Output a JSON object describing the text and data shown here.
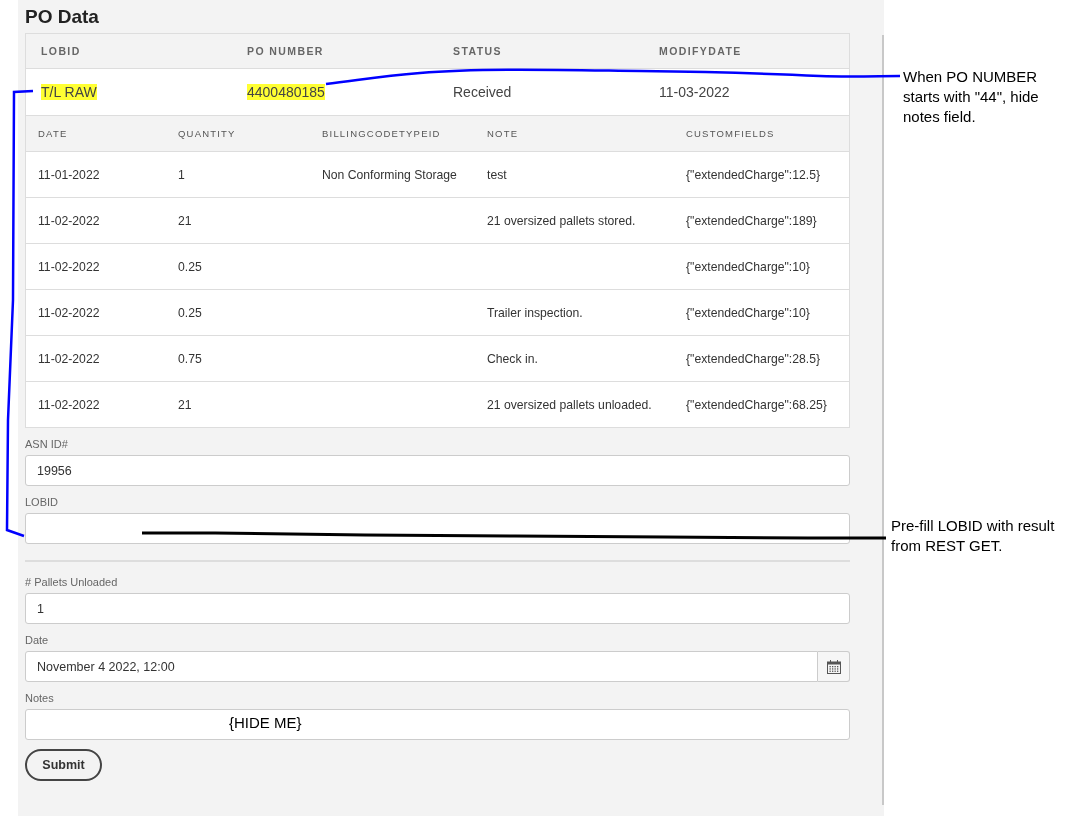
{
  "title": "PO Data",
  "po_table": {
    "columns": [
      "LOBID",
      "PO NUMBER",
      "STATUS",
      "MODIFYDATE"
    ],
    "row": [
      {
        "text": "T/L RAW",
        "highlighted": true
      },
      {
        "text": "4400480185",
        "highlighted": true
      },
      {
        "text": "Received",
        "highlighted": false
      },
      {
        "text": "11-03-2022",
        "highlighted": false
      }
    ]
  },
  "charges_table": {
    "columns": [
      "DATE",
      "QUANTITY",
      "BILLINGCODETYPEID",
      "NOTE",
      "CUSTOMFIELDS"
    ],
    "rows": [
      [
        "11-01-2022",
        "1",
        "Non Conforming Storage",
        "test",
        "{\"extendedCharge\":12.5}"
      ],
      [
        "11-02-2022",
        "21",
        "",
        "21 oversized pallets stored.",
        "{\"extendedCharge\":189}"
      ],
      [
        "11-02-2022",
        "0.25",
        "",
        "",
        "{\"extendedCharge\":10}"
      ],
      [
        "11-02-2022",
        "0.25",
        "",
        "Trailer inspection.",
        "{\"extendedCharge\":10}"
      ],
      [
        "11-02-2022",
        "0.75",
        "",
        "Check in.",
        "{\"extendedCharge\":28.5}"
      ],
      [
        "11-02-2022",
        "21",
        "",
        "21 oversized pallets unloaded.",
        "{\"extendedCharge\":68.25}"
      ]
    ]
  },
  "form": [
    {
      "kind": "text",
      "label": "ASN ID#",
      "value": "19956"
    },
    {
      "kind": "text",
      "label": "LOBID"
    },
    {
      "kind": "divider"
    },
    {
      "kind": "text",
      "label": "# Pallets Unloaded",
      "value": "1"
    },
    {
      "kind": "date",
      "label": "Date",
      "value": "November 4 2022, 12:00"
    },
    {
      "kind": "text",
      "label": "Notes",
      "overlay_note": "{HIDE ME}"
    }
  ],
  "submit": "Submit",
  "annotations": [
    {
      "text": "When PO NUMBER starts with \"44\", hide notes field.",
      "color": "#0000ff"
    },
    {
      "text": "Pre-fill LOBID with result from REST GET.",
      "color": "#000000"
    }
  ]
}
